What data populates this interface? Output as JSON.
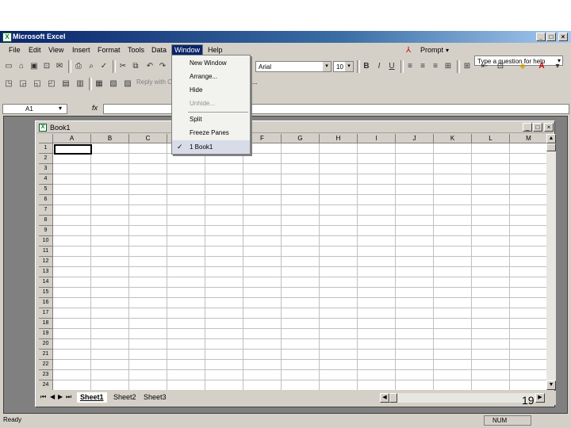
{
  "window": {
    "title": "Microsoft Excel",
    "min": "_",
    "max": "□",
    "close": "×"
  },
  "menubar": {
    "items": [
      "File",
      "Edit",
      "View",
      "Insert",
      "Format",
      "Tools",
      "Data",
      "Window",
      "Help"
    ],
    "help_placeholder": "Type a question for help",
    "help_arrow": "▾"
  },
  "toolbar": {
    "prompt_label": "Prompt",
    "font_name": "Arial",
    "font_size": "10",
    "bold": "B",
    "italic": "I",
    "underline": "U",
    "font_color_label": "A",
    "reply_label": "Reply with Changes...",
    "more": "..."
  },
  "formula": {
    "cell_ref": "A1",
    "fx": "fx",
    "arrow": "▾"
  },
  "workbook": {
    "title": "Book1",
    "min": "_",
    "max": "□",
    "close": "×"
  },
  "grid": {
    "columns": [
      "A",
      "B",
      "C",
      "D",
      "E",
      "F",
      "G",
      "H",
      "I",
      "J",
      "K",
      "L",
      "M"
    ],
    "rows": [
      "1",
      "2",
      "3",
      "4",
      "5",
      "6",
      "7",
      "8",
      "9",
      "10",
      "11",
      "12",
      "13",
      "14",
      "15",
      "16",
      "17",
      "18",
      "19",
      "20",
      "21",
      "22",
      "23",
      "24"
    ]
  },
  "sheets": [
    "Sheet1",
    "Sheet2",
    "Sheet3"
  ],
  "status": {
    "text": "Ready",
    "num": "NUM"
  },
  "window_menu": {
    "items": [
      {
        "label": "New Window",
        "disabled": false
      },
      {
        "label": "Arrange...",
        "disabled": false
      },
      {
        "label": "Hide",
        "disabled": false
      },
      {
        "label": "Unhide...",
        "disabled": true
      },
      {
        "label": "Split",
        "disabled": false
      },
      {
        "label": "Freeze Panes",
        "disabled": false
      },
      {
        "label": "1 Book1",
        "disabled": false,
        "checked": true
      }
    ],
    "check": "✓"
  },
  "slide_number": "19",
  "colors": {
    "title_bar": "#0a246a",
    "chrome": "#d4d0c8",
    "workspace": "#808080"
  }
}
